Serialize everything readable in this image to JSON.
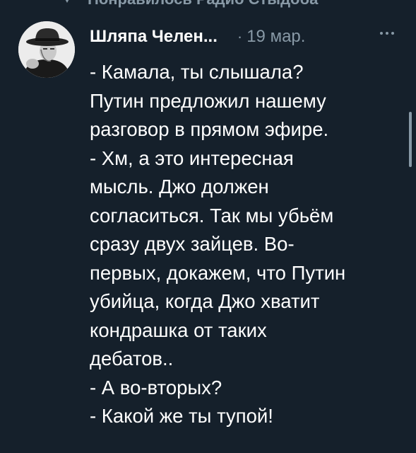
{
  "social_context": {
    "label": "Понравилось Радио Стыдоба",
    "icon": "heart-icon"
  },
  "tweet": {
    "author_name": "Шляпа Челен...",
    "separator": "·",
    "date": "19 мар.",
    "more_icon": "more-dots-icon",
    "avatar_icon": "avatar-man-in-hat",
    "lines": [
      "- Камала, ты слышала?",
      "Путин предложил нашему",
      "разговор в прямом эфире.",
      "- Хм, а это интересная",
      "мысль. Джо должен",
      "согласиться. Так мы убьём",
      "сразу двух зайцев. Во-",
      "первых, докажем, что Путин",
      "убийца, когда Джо хватит",
      "кондрашка от таких",
      "дебатов..",
      "- А во-вторых?",
      "- Какой же ты тупой!"
    ]
  },
  "colors": {
    "background": "#15202b",
    "primary_text": "#ffffff",
    "secondary_text": "#8899a6"
  }
}
